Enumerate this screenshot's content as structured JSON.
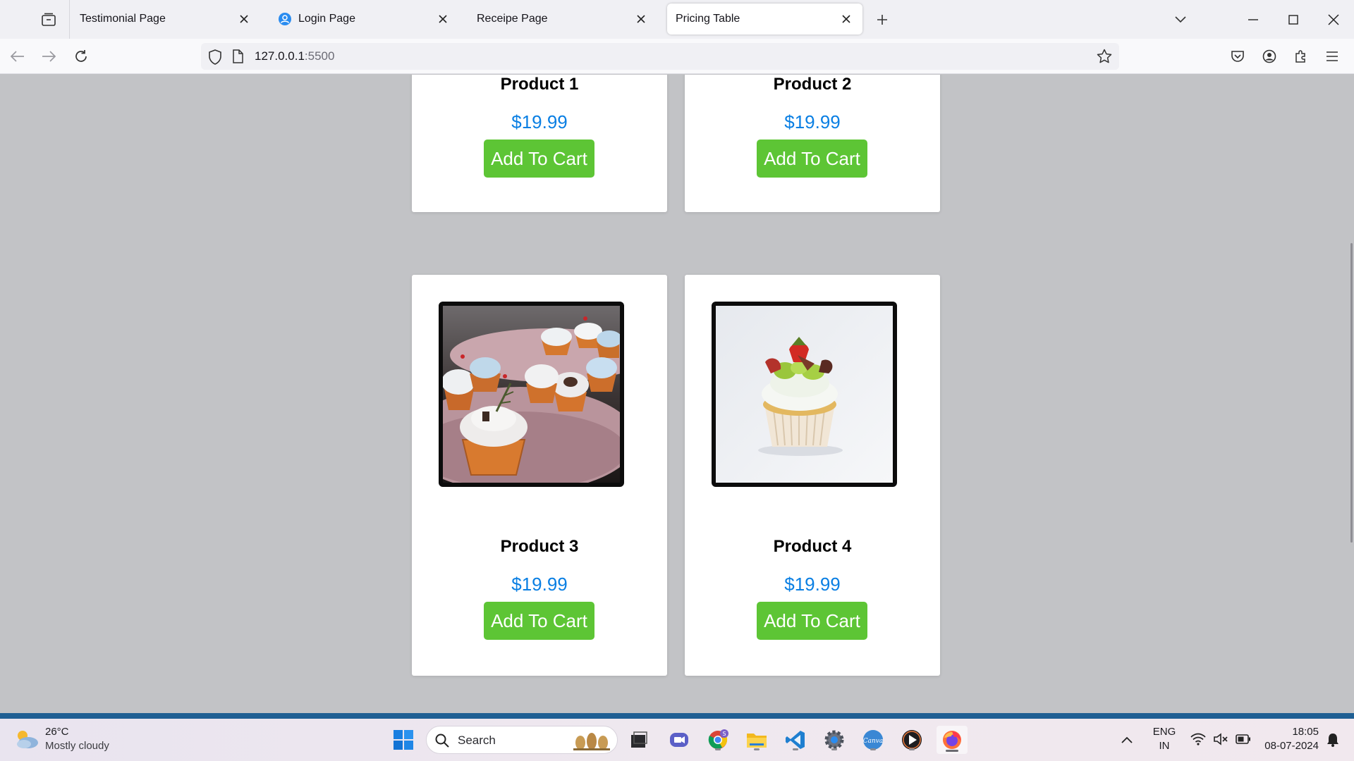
{
  "browser": {
    "tabs": [
      {
        "title": "Testimonial Page",
        "active": false
      },
      {
        "title": "Login Page",
        "active": false
      },
      {
        "title": "Receipe Page",
        "active": false
      },
      {
        "title": "Pricing Table",
        "active": true
      }
    ],
    "url_host": "127.0.0.1",
    "url_port": ":5500"
  },
  "products": [
    {
      "name": "Product 1",
      "price": "$19.99",
      "button": "Add To Cart"
    },
    {
      "name": "Product 2",
      "price": "$19.99",
      "button": "Add To Cart"
    },
    {
      "name": "Product 3",
      "price": "$19.99",
      "button": "Add To Cart"
    },
    {
      "name": "Product 4",
      "price": "$19.99",
      "button": "Add To Cart"
    }
  ],
  "colors": {
    "page_bg": "#c2c3c6",
    "price": "#0a7fe3",
    "button": "#5dc535"
  },
  "taskbar": {
    "weather_temp": "26°C",
    "weather_desc": "Mostly cloudy",
    "search_label": "Search",
    "lang_top": "ENG",
    "lang_bottom": "IN",
    "time": "18:05",
    "date": "08-07-2024"
  }
}
